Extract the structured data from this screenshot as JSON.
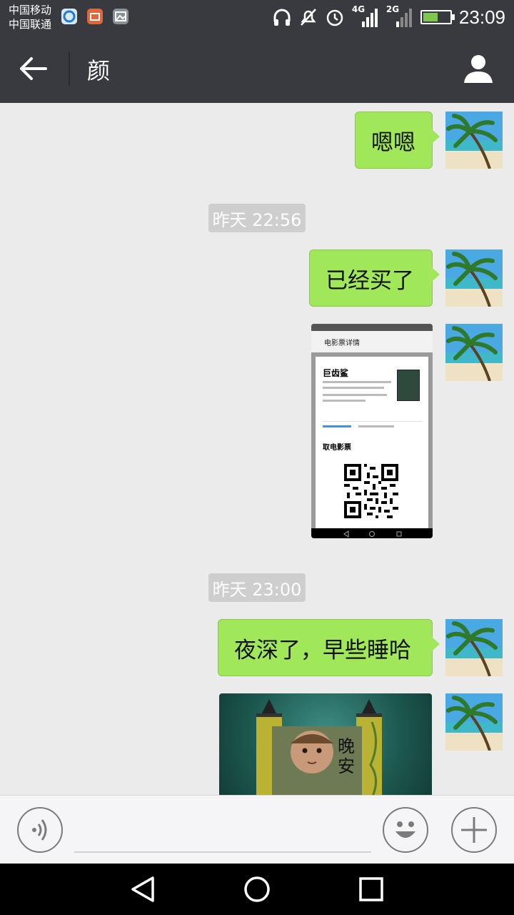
{
  "status_bar": {
    "carrier_1": "中国移动",
    "carrier_2": "中国联通",
    "network_1": "4G",
    "network_2": "2G",
    "time": "23:09",
    "notification_icons": [
      "browser-icon",
      "mail-icon",
      "gallery-icon"
    ],
    "battery_level": 0.55
  },
  "header": {
    "title": "颜",
    "back_icon": "back-arrow-icon",
    "profile_icon": "person-icon"
  },
  "messages": [
    {
      "type": "text",
      "text": "嗯嗯"
    },
    {
      "type": "time",
      "text": "昨天 22:56"
    },
    {
      "type": "text",
      "text": "已经买了"
    },
    {
      "type": "image",
      "image": {
        "header": "电影票详情",
        "movie": "巨齿鲨",
        "pickup": "取电影票"
      }
    },
    {
      "type": "time",
      "text": "昨天 23:00"
    },
    {
      "type": "text",
      "text": "夜深了，早些睡哈"
    },
    {
      "type": "image",
      "image": {
        "caption": "晚 安"
      }
    }
  ],
  "input_bar": {
    "voice_icon": "voice-icon",
    "input_placeholder": "",
    "emoji_icon": "emoji-icon",
    "plus_icon": "plus-icon"
  },
  "nav_bar": {
    "icons": [
      "back-triangle-icon",
      "home-circle-icon",
      "recents-square-icon"
    ]
  },
  "colors": {
    "status_bar_bg": "#383a3f",
    "header_bg": "#393a3f",
    "chat_bg": "#ebebeb",
    "bubble_green": "#a0e759",
    "time_badge_bg": "#cecece",
    "input_bar_bg": "#f5f5f7",
    "nav_bar_bg": "#000000"
  }
}
